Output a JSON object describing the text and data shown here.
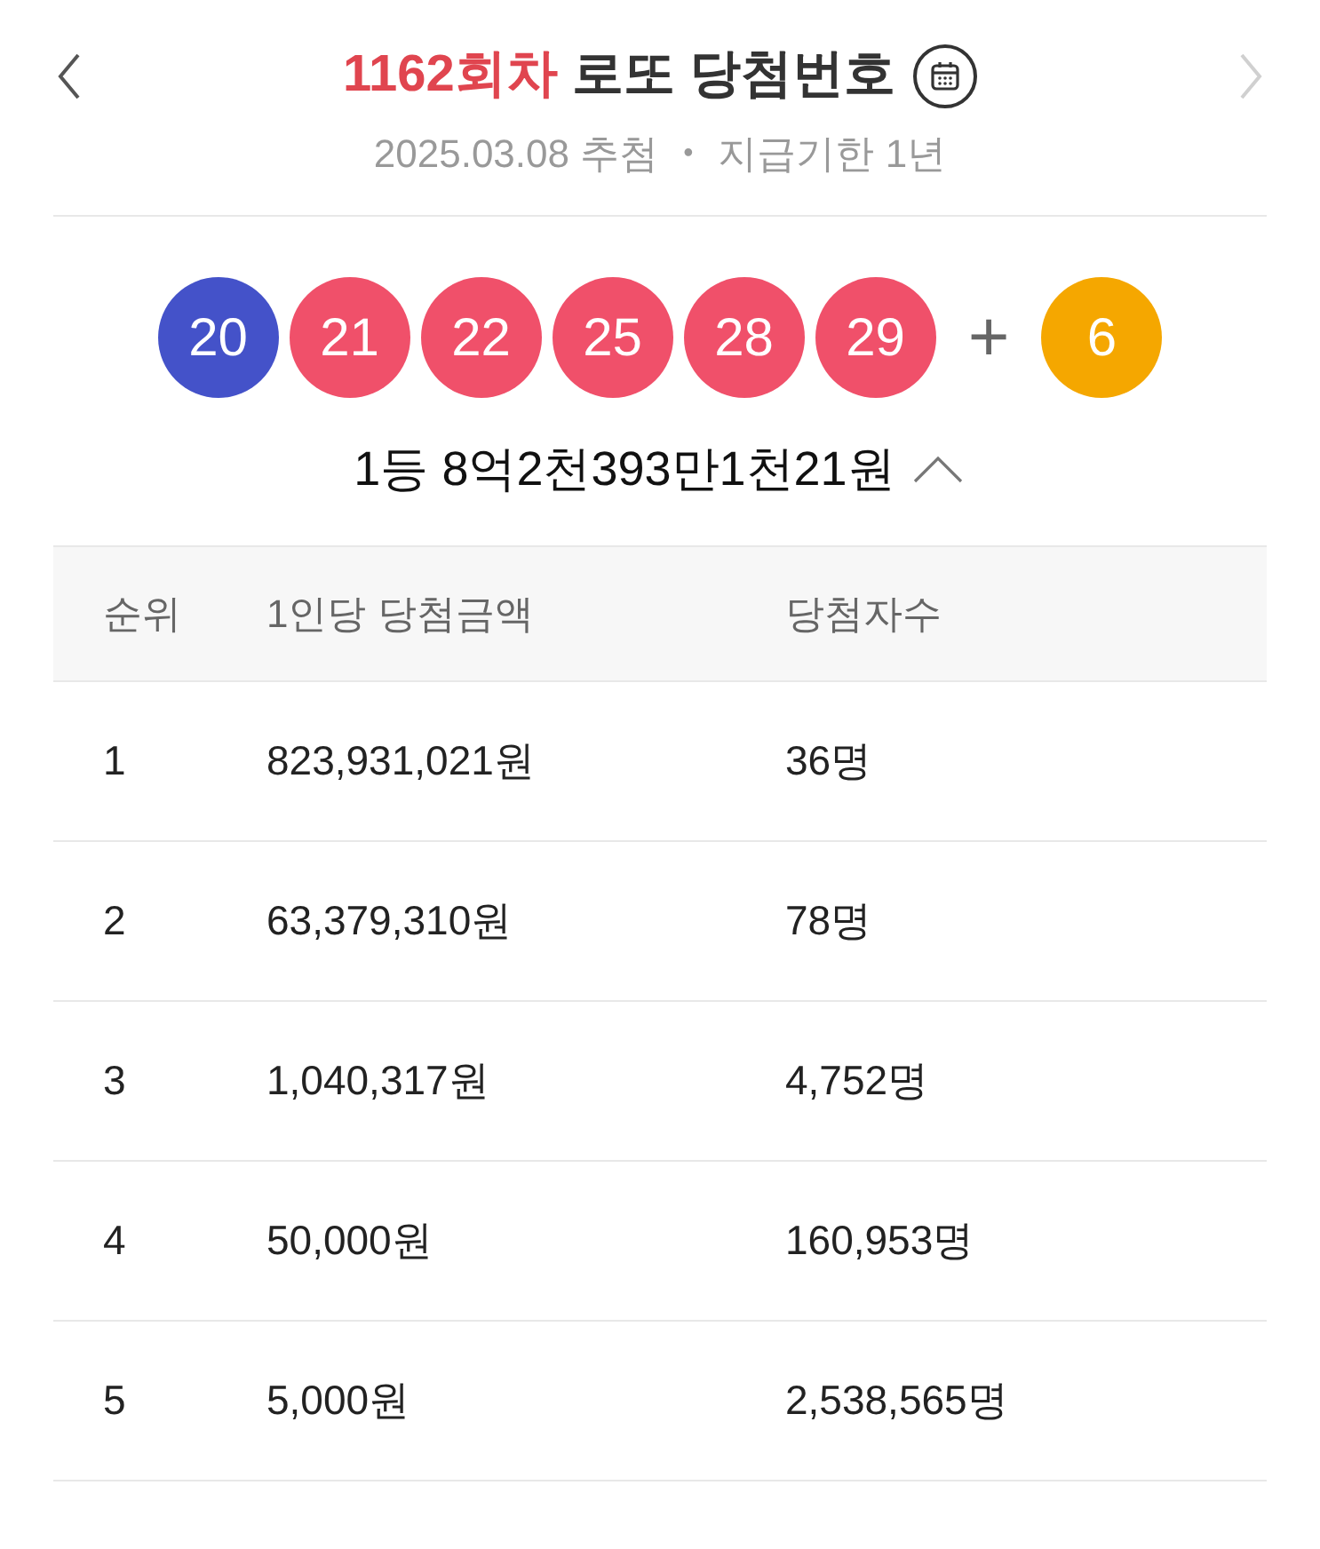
{
  "header": {
    "prev": {
      "disabled": false
    },
    "next": {
      "disabled": true
    },
    "title_round": "1162회차",
    "title_rest": "로또 당첨번호",
    "subtitle_date": "2025.03.08 추첨",
    "subtitle_sep": "•",
    "subtitle_deadline": "지급기한 1년"
  },
  "balls": [
    {
      "number": "20",
      "color": "#4452c9"
    },
    {
      "number": "21",
      "color": "#f0506a"
    },
    {
      "number": "22",
      "color": "#f0506a"
    },
    {
      "number": "25",
      "color": "#f0506a"
    },
    {
      "number": "28",
      "color": "#f0506a"
    },
    {
      "number": "29",
      "color": "#f0506a"
    }
  ],
  "plus": "+",
  "bonus": {
    "number": "6",
    "color": "#f5a700"
  },
  "first_prize": {
    "text": "1등 8억2천393만1천21원",
    "expanded": true
  },
  "table": {
    "columns": [
      "순위",
      "1인당 당첨금액",
      "당첨자수"
    ],
    "rows": [
      [
        "1",
        "823,931,021원",
        "36명"
      ],
      [
        "2",
        "63,379,310원",
        "78명"
      ],
      [
        "3",
        "1,040,317원",
        "4,752명"
      ],
      [
        "4",
        "50,000원",
        "160,953명"
      ],
      [
        "5",
        "5,000원",
        "2,538,565명"
      ]
    ]
  }
}
